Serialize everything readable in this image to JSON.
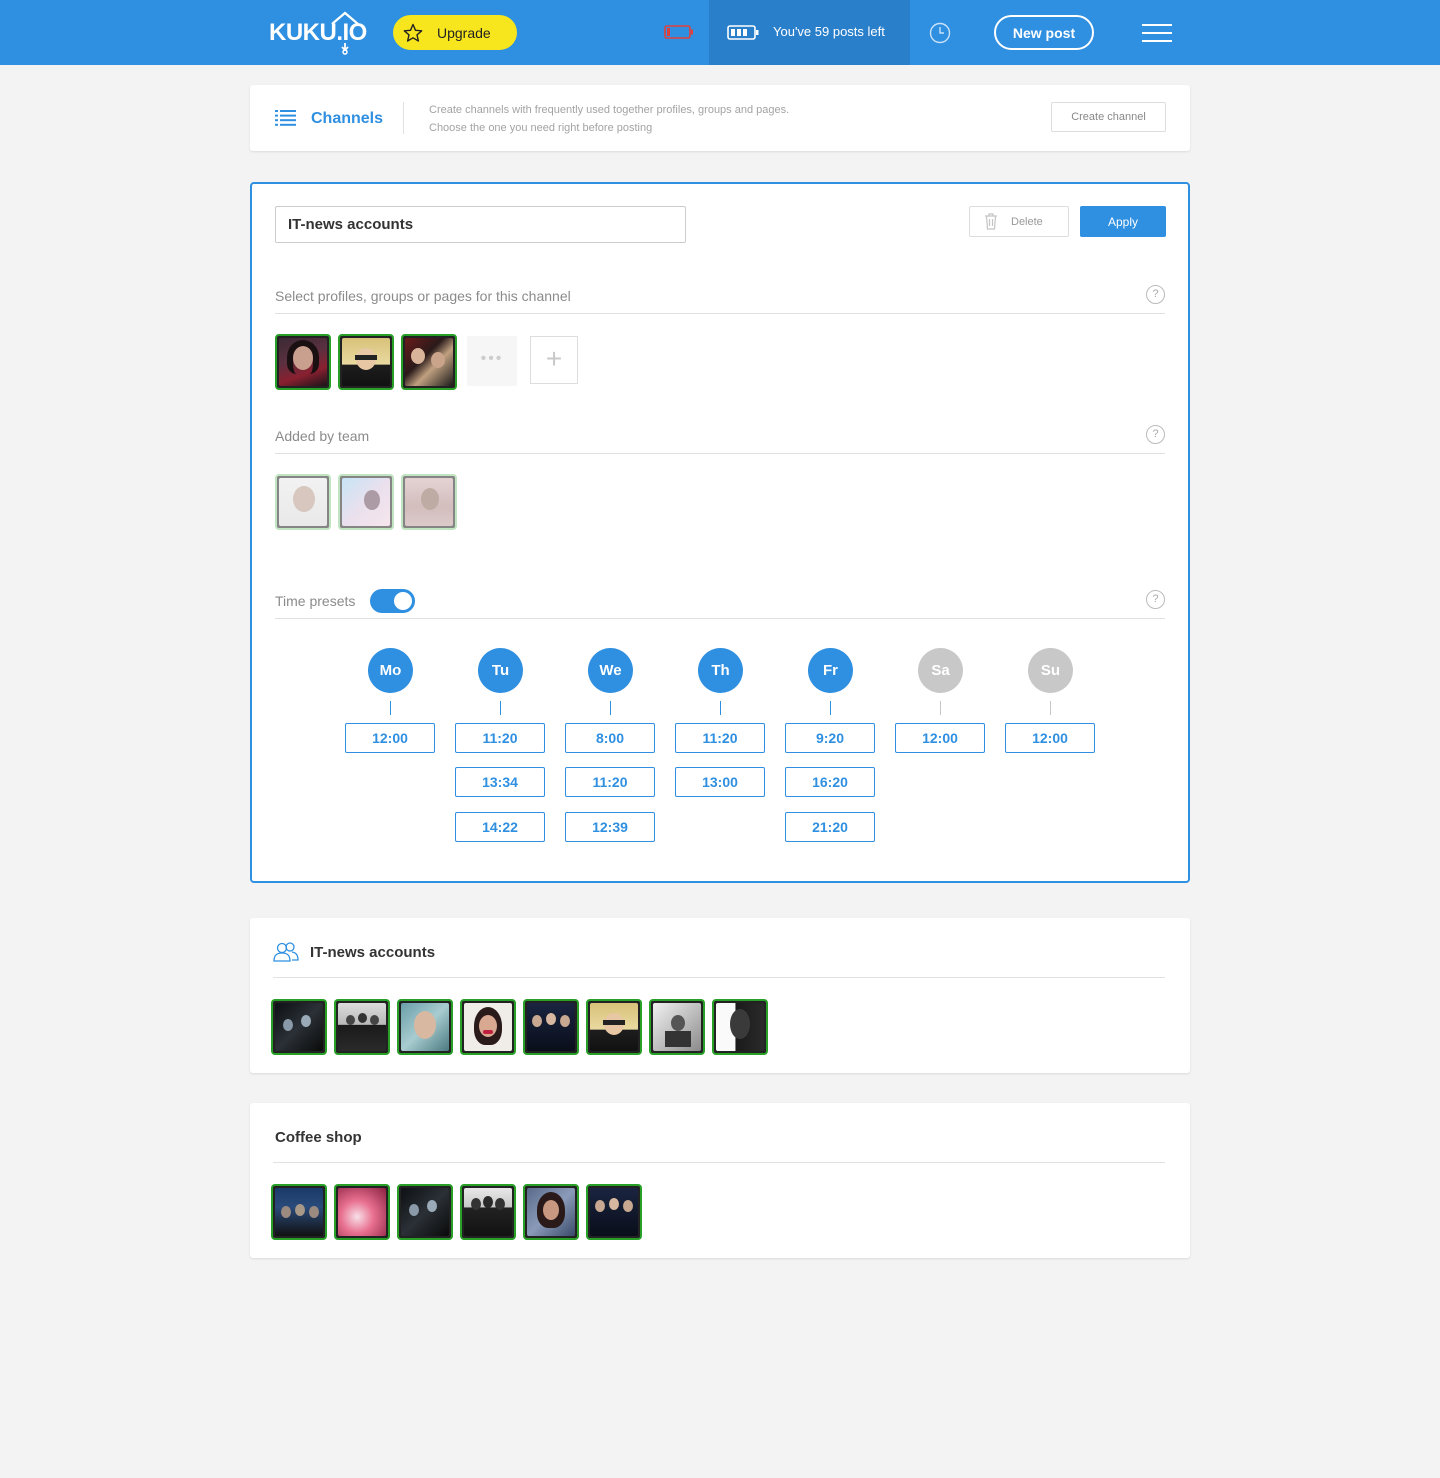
{
  "header": {
    "logo_text": "KUKU.IO",
    "upgrade_label": "Upgrade",
    "posts_left_text": "You've  59 posts left",
    "new_post_label": "New post"
  },
  "channels": {
    "title": "Channels",
    "description_line1": "Create channels with frequently used together profiles, groups and pages.",
    "description_line2": "Choose the one you need right before posting",
    "create_label": "Create channel"
  },
  "editor": {
    "name_value": "IT-news accounts",
    "delete_label": "Delete",
    "apply_label": "Apply",
    "select_label": "Select profiles, groups or pages for this channel",
    "team_label": "Added by team",
    "presets_label": "Time presets",
    "presets_enabled": true,
    "help_glyph": "?",
    "more_glyph": "•••",
    "add_glyph": "+",
    "days": [
      {
        "label": "Mo",
        "active": true,
        "times": [
          "12:00"
        ]
      },
      {
        "label": "Tu",
        "active": true,
        "times": [
          "11:20",
          "13:34",
          "14:22"
        ]
      },
      {
        "label": "We",
        "active": true,
        "times": [
          "8:00",
          "11:20",
          "12:39"
        ]
      },
      {
        "label": "Th",
        "active": true,
        "times": [
          "11:20",
          "13:00"
        ]
      },
      {
        "label": "Fr",
        "active": true,
        "times": [
          "9:20",
          "16:20",
          "21:20"
        ]
      },
      {
        "label": "Sa",
        "active": false,
        "times": [
          "12:00"
        ]
      },
      {
        "label": "Su",
        "active": false,
        "times": [
          "12:00"
        ]
      }
    ]
  },
  "groups": [
    {
      "title": "IT-news accounts",
      "icon": "users-icon",
      "avatar_count": 8
    },
    {
      "title": "Coffee shop",
      "avatar_count": 6
    }
  ],
  "colors": {
    "brand": "#2f8fe0",
    "upgrade": "#f7e51e",
    "avatar_border": "#28a028",
    "inactive_day": "#c8c8c8"
  }
}
